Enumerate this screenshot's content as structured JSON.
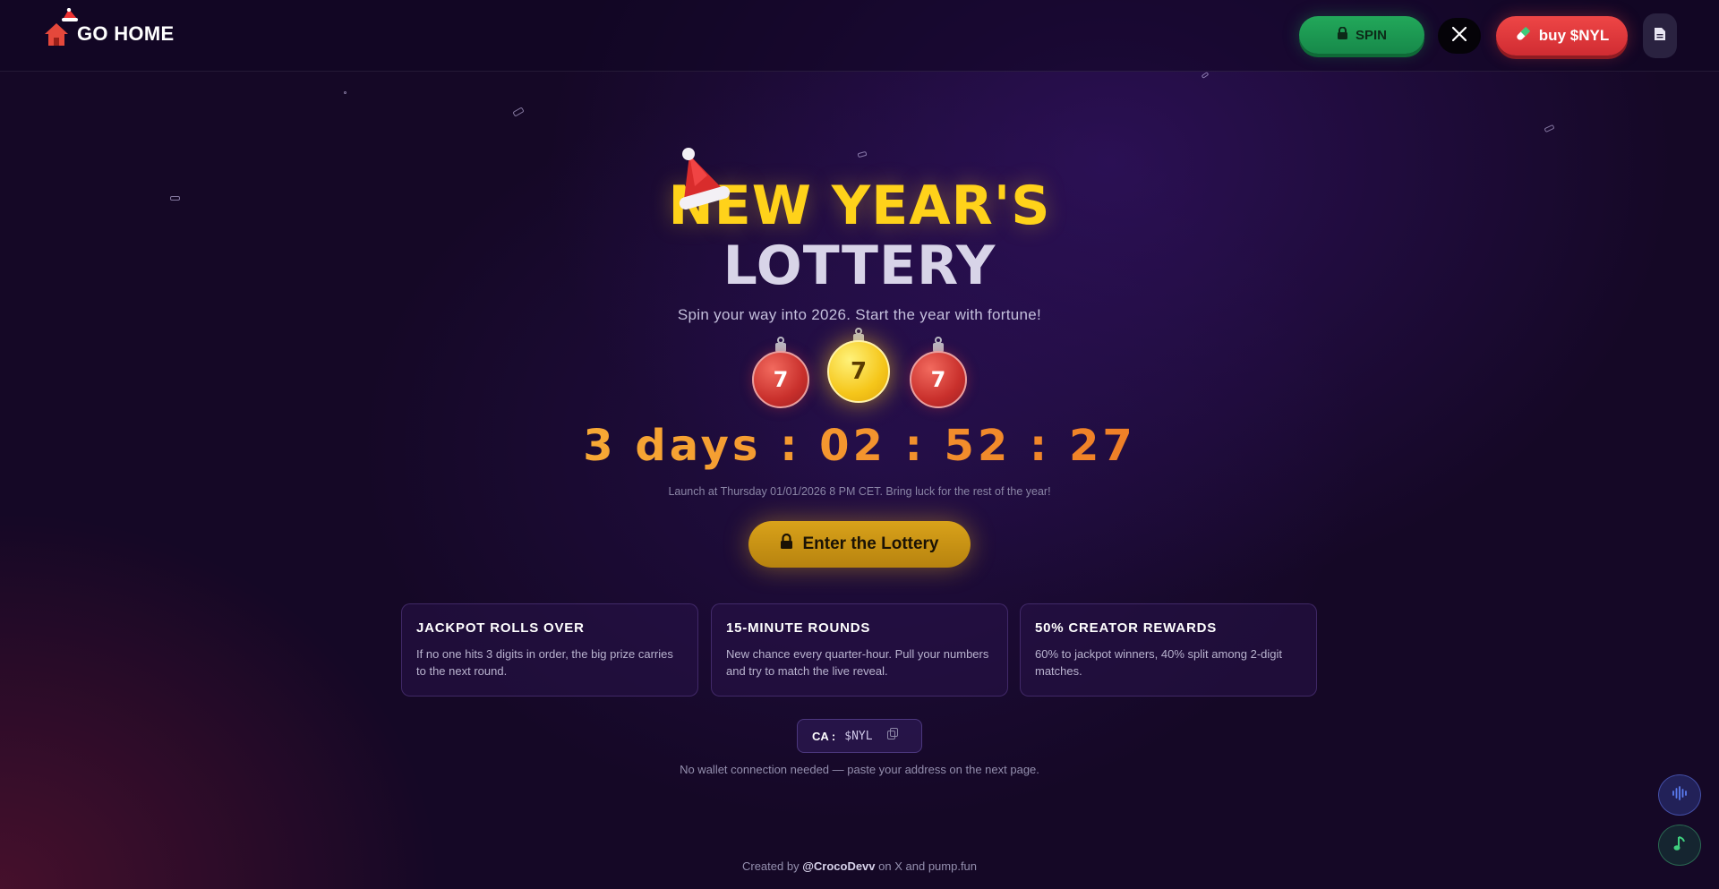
{
  "header": {
    "logo_text": "GO HOME",
    "spin_label": "SPIN",
    "buy_label": "buy $NYL"
  },
  "hero": {
    "title_line1": "NEW YEAR'S",
    "title_line2": "LOTTERY",
    "subtitle": "Spin your way into 2026. Start the year with fortune!",
    "balls": [
      "7",
      "7",
      "7"
    ],
    "countdown": "3 days : 02 : 52 : 27",
    "launch_note": "Launch at Thursday 01/01/2026 8 PM CET. Bring luck for the rest of the year!",
    "enter_label": "Enter the Lottery"
  },
  "features": [
    {
      "title": "JACKPOT ROLLS OVER",
      "body": "If no one hits 3 digits in order, the big prize carries to the next round."
    },
    {
      "title": "15-MINUTE ROUNDS",
      "body": "New chance every quarter-hour. Pull your numbers and try to match the live reveal."
    },
    {
      "title": "50% CREATOR REWARDS",
      "body": "60% to jackpot winners, 40% split among 2-digit matches."
    }
  ],
  "ca": {
    "label": "CA :",
    "value": "$NYL"
  },
  "no_wallet_note": "No wallet connection needed — paste your address on the next page.",
  "footer": {
    "prefix": "Created by",
    "handle": "@CrocoDevv",
    "suffix": "on X and pump.fun"
  },
  "icons": {
    "logo": "house-icon",
    "spin": "lock-icon",
    "x": "x-logo-icon",
    "buy": "pill-icon",
    "doc": "document-icon",
    "enter": "lock-icon",
    "copy": "copy-icon",
    "fab1": "sound-wave-icon",
    "fab2": "music-note-icon"
  },
  "colors": {
    "background": "#150826",
    "gold": "#ffd21a",
    "spin_green": "#22a85a",
    "buy_red": "#ee4646",
    "countdown_orange": "#f39c2e",
    "enter_gold": "#d9a21a"
  }
}
